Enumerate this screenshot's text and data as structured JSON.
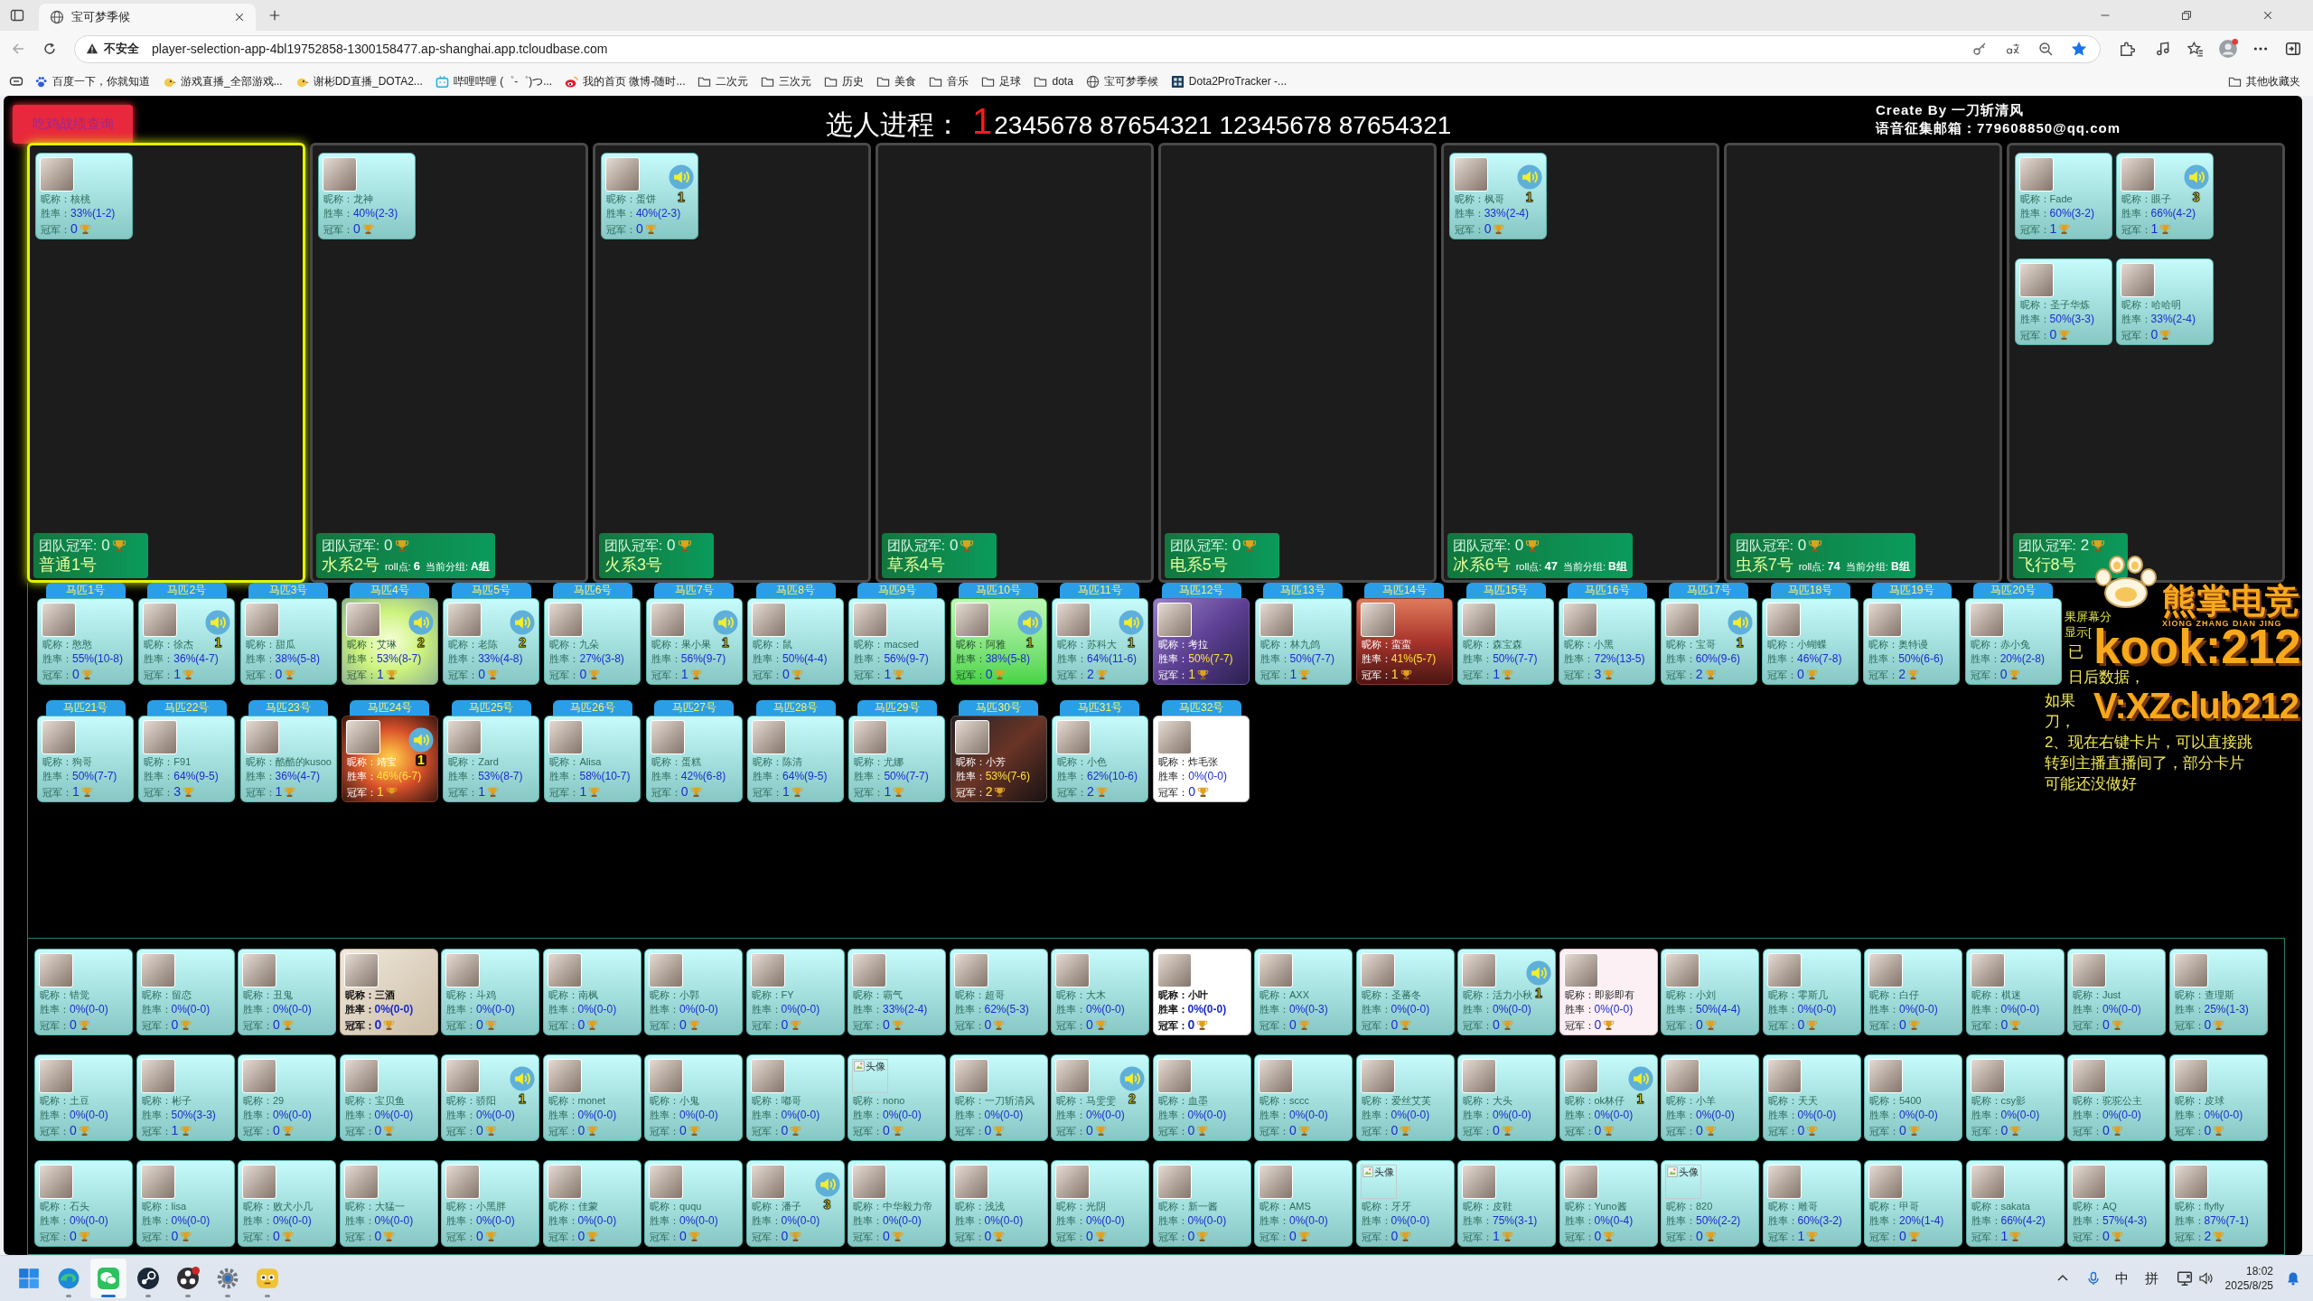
{
  "browser": {
    "tab_title": "宝可梦季候",
    "security_label": "不安全",
    "url": "player-selection-app-4bl19752858-1300158477.ap-shanghai.app.tcloudbase.com",
    "bookmarks": [
      {
        "kind": "paw",
        "label": "百度一下，你就知道"
      },
      {
        "kind": "bird",
        "label": "游戏直播_全部游戏..."
      },
      {
        "kind": "bird",
        "label": "谢彬DD直播_DOTA2..."
      },
      {
        "kind": "tv",
        "label": "哔哩哔哩 (゜-゜)つ..."
      },
      {
        "kind": "eye",
        "label": "我的首页 微博-随时..."
      },
      {
        "kind": "folder",
        "label": "二次元"
      },
      {
        "kind": "folder",
        "label": "三次元"
      },
      {
        "kind": "folder",
        "label": "历史"
      },
      {
        "kind": "folder",
        "label": "美食"
      },
      {
        "kind": "folder",
        "label": "音乐"
      },
      {
        "kind": "folder",
        "label": "足球"
      },
      {
        "kind": "folder",
        "label": "dota"
      },
      {
        "kind": "globe",
        "label": "宝可梦季候"
      },
      {
        "kind": "tile",
        "label": "Dota2ProTracker -..."
      }
    ],
    "other_bookmarks": "其他收藏夹"
  },
  "page": {
    "query_button": "吃鸡战绩查询",
    "progress": {
      "label": "选人进程：",
      "current": "1",
      "rest": "2345678 87654321 12345678 87654321"
    },
    "credits": [
      "Create By 一刀斩清风",
      "语音征集邮箱：779608850@qq.com"
    ],
    "teams": [
      {
        "name": "普通1号",
        "selected": true,
        "champ_label": "团队冠军:",
        "champ": "0",
        "members": [
          {
            "nick_label": "昵称：",
            "nick": "核桃",
            "rate_label": "胜率：",
            "rate": "33%(1-2)",
            "champ_label": "冠军：",
            "champ": "0",
            "kind": "plain"
          }
        ]
      },
      {
        "name": "水系2号",
        "selected": false,
        "champ_label": "团队冠军:",
        "champ": "0",
        "roll_label": "roll点:",
        "roll": "6",
        "group_label": "当前分组:",
        "group": "A组",
        "members": [
          {
            "nick_label": "昵称：",
            "nick": "龙神",
            "rate_label": "胜率：",
            "rate": "40%(2-3)",
            "champ_label": "冠军：",
            "champ": "0",
            "kind": "plain"
          }
        ]
      },
      {
        "name": "火系3号",
        "selected": false,
        "champ_label": "团队冠军:",
        "champ": "0",
        "members": [
          {
            "nick_label": "昵称：",
            "nick": "蛋饼",
            "rate_label": "胜率：",
            "rate": "40%(2-3)",
            "champ_label": "冠军：",
            "champ": "0",
            "kind": "plain",
            "voice": "1"
          }
        ]
      },
      {
        "name": "草系4号",
        "selected": false,
        "champ_label": "团队冠军:",
        "champ": "0"
      },
      {
        "name": "电系5号",
        "selected": false,
        "champ_label": "团队冠军:",
        "champ": "0"
      },
      {
        "name": "冰系6号",
        "selected": false,
        "champ_label": "团队冠军:",
        "champ": "0",
        "roll_label": "roll点:",
        "roll": "47",
        "group_label": "当前分组:",
        "group": "B组",
        "members": [
          {
            "nick_label": "昵称：",
            "nick": "枫哥",
            "rate_label": "胜率：",
            "rate": "33%(2-4)",
            "champ_label": "冠军：",
            "champ": "0",
            "kind": "plain",
            "voice": "1"
          }
        ]
      },
      {
        "name": "虫系7号",
        "selected": false,
        "champ_label": "团队冠军:",
        "champ": "0",
        "roll_label": "roll点:",
        "roll": "74",
        "group_label": "当前分组:",
        "group": "B组"
      },
      {
        "name": "飞行8号",
        "selected": false,
        "champ_label": "团队冠军:",
        "champ": "2",
        "members": [
          {
            "nick_label": "昵称：",
            "nick": "Fade",
            "rate_label": "胜率：",
            "rate": "60%(3-2)",
            "champ_label": "冠军：",
            "champ": "1",
            "kind": "plain"
          },
          {
            "nick_label": "昵称：",
            "nick": "眼子",
            "rate_label": "胜率：",
            "rate": "66%(4-2)",
            "champ_label": "冠军：",
            "champ": "1",
            "kind": "plain",
            "voice": "3"
          },
          {
            "nick_label": "昵称：",
            "nick": "圣子华炼",
            "rate_label": "胜率：",
            "rate": "50%(3-3)",
            "champ_label": "冠军：",
            "champ": "0",
            "kind": "plain"
          },
          {
            "nick_label": "昵称：",
            "nick": "哈哈明",
            "rate_label": "胜率：",
            "rate": "33%(2-4)",
            "champ_label": "冠军：",
            "champ": "0",
            "kind": "plain"
          }
        ]
      }
    ],
    "horses": [
      {
        "label": "马匹1号",
        "player": {
          "nick_label": "昵称：",
          "nick": "憨憨",
          "rate_label": "胜率：",
          "rate": "55%(10-8)",
          "champ_label": "冠军：",
          "champ": "0",
          "kind": "plain"
        }
      },
      {
        "label": "马匹2号",
        "player": {
          "nick_label": "昵称：",
          "nick": "徐杰",
          "rate_label": "胜率：",
          "rate": "36%(4-7)",
          "champ_label": "冠军：",
          "champ": "1",
          "kind": "plain",
          "voice": "1"
        }
      },
      {
        "label": "马匹3号",
        "player": {
          "nick_label": "昵称：",
          "nick": "甜瓜",
          "rate_label": "胜率：",
          "rate": "38%(5-8)",
          "champ_label": "冠军：",
          "champ": "0",
          "kind": "plain"
        }
      },
      {
        "label": "马匹4号",
        "player": {
          "nick_label": "昵称：",
          "nick": "艾琳",
          "rate_label": "胜率：",
          "rate": "53%(8-7)",
          "champ_label": "冠军：",
          "champ": "1",
          "kind": "glow",
          "voice": "2"
        }
      },
      {
        "label": "马匹5号",
        "player": {
          "nick_label": "昵称：",
          "nick": "老陈",
          "rate_label": "胜率：",
          "rate": "33%(4-8)",
          "champ_label": "冠军：",
          "champ": "0",
          "kind": "plain",
          "voice": "2"
        }
      },
      {
        "label": "马匹6号",
        "player": {
          "nick_label": "昵称：",
          "nick": "九朵",
          "rate_label": "胜率：",
          "rate": "27%(3-8)",
          "champ_label": "冠军：",
          "champ": "0",
          "kind": "plain"
        }
      },
      {
        "label": "马匹7号",
        "player": {
          "nick_label": "昵称：",
          "nick": "果小果",
          "rate_label": "胜率：",
          "rate": "56%(9-7)",
          "champ_label": "冠军：",
          "champ": "1",
          "kind": "plain",
          "voice": "1"
        }
      },
      {
        "label": "马匹8号",
        "player": {
          "nick_label": "昵称：",
          "nick": "鼠",
          "rate_label": "胜率：",
          "rate": "50%(4-4)",
          "champ_label": "冠军：",
          "champ": "0",
          "kind": "plain"
        }
      },
      {
        "label": "马匹9号",
        "player": {
          "nick_label": "昵称：",
          "nick": "macsed",
          "rate_label": "胜率：",
          "rate": "56%(9-7)",
          "champ_label": "冠军：",
          "champ": "1",
          "kind": "plain"
        }
      },
      {
        "label": "马匹10号",
        "player": {
          "nick_label": "昵称：",
          "nick": "阿雅",
          "rate_label": "胜率：",
          "rate": "38%(5-8)",
          "champ_label": "冠军：",
          "champ": "0",
          "kind": "green",
          "voice": "1"
        }
      },
      {
        "label": "马匹11号",
        "player": {
          "nick_label": "昵称：",
          "nick": "苏科大",
          "rate_label": "胜率：",
          "rate": "64%(11-6)",
          "champ_label": "冠军：",
          "champ": "2",
          "kind": "plain",
          "voice": "1"
        }
      },
      {
        "label": "马匹12号",
        "player": {
          "nick_label": "昵称：",
          "nick": "考拉",
          "rate_label": "胜率：",
          "rate": "50%(7-7)",
          "champ_label": "冠军：",
          "champ": "1",
          "kind": "violet"
        }
      },
      {
        "label": "马匹13号",
        "player": {
          "nick_label": "昵称：",
          "nick": "林九鸽",
          "rate_label": "胜率：",
          "rate": "50%(7-7)",
          "champ_label": "冠军：",
          "champ": "1",
          "kind": "plain"
        }
      },
      {
        "label": "马匹14号",
        "player": {
          "nick_label": "昵称：",
          "nick": "蛮蛮",
          "rate_label": "胜率：",
          "rate": "41%(5-7)",
          "champ_label": "冠军：",
          "champ": "1",
          "kind": "crimson"
        }
      },
      {
        "label": "马匹15号",
        "player": {
          "nick_label": "昵称：",
          "nick": "森宝森",
          "rate_label": "胜率：",
          "rate": "50%(7-7)",
          "champ_label": "冠军：",
          "champ": "1",
          "kind": "plain"
        }
      },
      {
        "label": "马匹16号",
        "player": {
          "nick_label": "昵称：",
          "nick": "小黑",
          "rate_label": "胜率：",
          "rate": "72%(13-5)",
          "champ_label": "冠军：",
          "champ": "3",
          "kind": "plain"
        }
      },
      {
        "label": "马匹17号",
        "player": {
          "nick_label": "昵称：",
          "nick": "宝哥",
          "rate_label": "胜率：",
          "rate": "60%(9-6)",
          "champ_label": "冠军：",
          "champ": "2",
          "kind": "plain",
          "voice": "1"
        }
      },
      {
        "label": "马匹18号",
        "player": {
          "nick_label": "昵称：",
          "nick": "小蝴蝶",
          "rate_label": "胜率：",
          "rate": "46%(7-8)",
          "champ_label": "冠军：",
          "champ": "0",
          "kind": "plain"
        }
      },
      {
        "label": "马匹19号",
        "player": {
          "nick_label": "昵称：",
          "nick": "奥特谩",
          "rate_label": "胜率：",
          "rate": "50%(6-6)",
          "champ_label": "冠军：",
          "champ": "2",
          "kind": "plain"
        }
      },
      {
        "label": "马匹20号",
        "player": {
          "nick_label": "昵称：",
          "nick": "赤小兔",
          "rate_label": "胜率：",
          "rate": "20%(2-8)",
          "champ_label": "冠军：",
          "champ": "0",
          "kind": "plain"
        }
      },
      {
        "label": "马匹21号",
        "player": {
          "nick_label": "昵称：",
          "nick": "狗哥",
          "rate_label": "胜率：",
          "rate": "50%(7-7)",
          "champ_label": "冠军：",
          "champ": "1",
          "kind": "plain"
        }
      },
      {
        "label": "马匹22号",
        "player": {
          "nick_label": "昵称：",
          "nick": "F91",
          "rate_label": "胜率：",
          "rate": "64%(9-5)",
          "champ_label": "冠军：",
          "champ": "3",
          "kind": "plain"
        }
      },
      {
        "label": "马匹23号",
        "player": {
          "nick_label": "昵称：",
          "nick": "酷酷的kusoo",
          "rate_label": "胜率：",
          "rate": "36%(4-7)",
          "champ_label": "冠军：",
          "champ": "1",
          "kind": "plain"
        }
      },
      {
        "label": "马匹24号",
        "player": {
          "nick_label": "昵称：",
          "nick": "靖宝",
          "rate_label": "胜率：",
          "rate": "46%(6-7)",
          "champ_label": "冠军：",
          "champ": "1",
          "kind": "fire",
          "voice": "1"
        }
      },
      {
        "label": "马匹25号",
        "player": {
          "nick_label": "昵称：",
          "nick": "Zard",
          "rate_label": "胜率：",
          "rate": "53%(8-7)",
          "champ_label": "冠军：",
          "champ": "1",
          "kind": "plain"
        }
      },
      {
        "label": "马匹26号",
        "player": {
          "nick_label": "昵称：",
          "nick": "Alisa",
          "rate_label": "胜率：",
          "rate": "58%(10-7)",
          "champ_label": "冠军：",
          "champ": "1",
          "kind": "plain"
        }
      },
      {
        "label": "马匹27号",
        "player": {
          "nick_label": "昵称：",
          "nick": "蛋糕",
          "rate_label": "胜率：",
          "rate": "42%(6-8)",
          "champ_label": "冠军：",
          "champ": "0",
          "kind": "plain"
        }
      },
      {
        "label": "马匹28号",
        "player": {
          "nick_label": "昵称：",
          "nick": "陈清",
          "rate_label": "胜率：",
          "rate": "64%(9-5)",
          "champ_label": "冠军：",
          "champ": "1",
          "kind": "plain"
        }
      },
      {
        "label": "马匹29号",
        "player": {
          "nick_label": "昵称：",
          "nick": "尤娜",
          "rate_label": "胜率：",
          "rate": "50%(7-7)",
          "champ_label": "冠军：",
          "champ": "1",
          "kind": "plain"
        }
      },
      {
        "label": "马匹30号",
        "player": {
          "nick_label": "昵称：",
          "nick": "小芳",
          "rate_label": "胜率：",
          "rate": "53%(7-6)",
          "champ_label": "冠军：",
          "champ": "2",
          "kind": "dark"
        }
      },
      {
        "label": "马匹31号",
        "player": {
          "nick_label": "昵称：",
          "nick": "小色",
          "rate_label": "胜率：",
          "rate": "62%(10-6)",
          "champ_label": "冠军：",
          "champ": "2",
          "kind": "plain"
        }
      },
      {
        "label": "马匹32号",
        "player": {
          "nick_label": "昵称：",
          "nick": "炸毛张",
          "rate_label": "胜率：",
          "rate": "0%(0-0)",
          "champ_label": "冠军：",
          "champ": "0",
          "kind": "white"
        }
      }
    ],
    "pool": [
      {
        "nick_label": "昵称：",
        "nick": "错觉",
        "rate_label": "胜率：",
        "rate": "0%(0-0)",
        "champ_label": "冠军：",
        "champ": "0",
        "kind": "plain"
      },
      {
        "nick_label": "昵称：",
        "nick": "留恋",
        "rate_label": "胜率：",
        "rate": "0%(0-0)",
        "champ_label": "冠军：",
        "champ": "0",
        "kind": "plain"
      },
      {
        "nick_label": "昵称：",
        "nick": "丑鬼",
        "rate_label": "胜率：",
        "rate": "0%(0-0)",
        "champ_label": "冠军：",
        "champ": "0",
        "kind": "plain"
      },
      {
        "nick_label": "昵称：",
        "nick": "三酒",
        "rate_label": "胜率：",
        "rate": "0%(0-0)",
        "champ_label": "冠军：",
        "champ": "0",
        "kind": "sketch"
      },
      {
        "nick_label": "昵称：",
        "nick": "斗鸡",
        "rate_label": "胜率：",
        "rate": "0%(0-0)",
        "champ_label": "冠军：",
        "champ": "0",
        "kind": "plain"
      },
      {
        "nick_label": "昵称：",
        "nick": "南枫",
        "rate_label": "胜率：",
        "rate": "0%(0-0)",
        "champ_label": "冠军：",
        "champ": "0",
        "kind": "plain"
      },
      {
        "nick_label": "昵称：",
        "nick": "小郭",
        "rate_label": "胜率：",
        "rate": "0%(0-0)",
        "champ_label": "冠军：",
        "champ": "0",
        "kind": "plain"
      },
      {
        "nick_label": "昵称：",
        "nick": "FY",
        "rate_label": "胜率：",
        "rate": "0%(0-0)",
        "champ_label": "冠军：",
        "champ": "0",
        "kind": "plain"
      },
      {
        "nick_label": "昵称：",
        "nick": "霸气",
        "rate_label": "胜率：",
        "rate": "33%(2-4)",
        "champ_label": "冠军：",
        "champ": "0",
        "kind": "plain"
      },
      {
        "nick_label": "昵称：",
        "nick": "超哥",
        "rate_label": "胜率：",
        "rate": "62%(5-3)",
        "champ_label": "冠军：",
        "champ": "0",
        "kind": "plain"
      },
      {
        "nick_label": "昵称：",
        "nick": "大木",
        "rate_label": "胜率：",
        "rate": "0%(0-0)",
        "champ_label": "冠军：",
        "champ": "0",
        "kind": "plain"
      },
      {
        "nick_label": "昵称：",
        "nick": "小叶",
        "rate_label": "胜率：",
        "rate": "0%(0-0)",
        "champ_label": "冠军：",
        "champ": "0",
        "kind": "bold"
      },
      {
        "nick_label": "昵称：",
        "nick": "AXX",
        "rate_label": "胜率：",
        "rate": "0%(0-3)",
        "champ_label": "冠军：",
        "champ": "0",
        "kind": "plain"
      },
      {
        "nick_label": "昵称：",
        "nick": "圣蕃冬",
        "rate_label": "胜率：",
        "rate": "0%(0-0)",
        "champ_label": "冠军：",
        "champ": "0",
        "kind": "plain"
      },
      {
        "nick_label": "昵称：",
        "nick": "活力小秋",
        "rate_label": "胜率：",
        "rate": "0%(0-0)",
        "champ_label": "冠军：",
        "champ": "0",
        "kind": "plain",
        "voice": "1"
      },
      {
        "nick_label": "昵称：",
        "nick": "即影即有",
        "rate_label": "胜率：",
        "rate": "0%(0-0)",
        "champ_label": "冠军：",
        "champ": "0",
        "kind": "pink"
      },
      {
        "nick_label": "昵称：",
        "nick": "小刘",
        "rate_label": "胜率：",
        "rate": "50%(4-4)",
        "champ_label": "冠军：",
        "champ": "0",
        "kind": "plain"
      },
      {
        "nick_label": "昵称：",
        "nick": "零斯几",
        "rate_label": "胜率：",
        "rate": "0%(0-0)",
        "champ_label": "冠军：",
        "champ": "0",
        "kind": "plain"
      },
      {
        "nick_label": "昵称：",
        "nick": "白仔",
        "rate_label": "胜率：",
        "rate": "0%(0-0)",
        "champ_label": "冠军：",
        "champ": "0",
        "kind": "plain"
      },
      {
        "nick_label": "昵称：",
        "nick": "棋迷",
        "rate_label": "胜率：",
        "rate": "0%(0-0)",
        "champ_label": "冠军：",
        "champ": "0",
        "kind": "plain"
      },
      {
        "nick_label": "昵称：",
        "nick": "Just",
        "rate_label": "胜率：",
        "rate": "0%(0-0)",
        "champ_label": "冠军：",
        "champ": "0",
        "kind": "plain"
      },
      {
        "nick_label": "昵称：",
        "nick": "查理斯",
        "rate_label": "胜率：",
        "rate": "25%(1-3)",
        "champ_label": "冠军：",
        "champ": "0",
        "kind": "plain"
      },
      {
        "nick_label": "昵称：",
        "nick": "土豆",
        "rate_label": "胜率：",
        "rate": "0%(0-0)",
        "champ_label": "冠军：",
        "champ": "0",
        "kind": "plain"
      },
      {
        "nick_label": "昵称：",
        "nick": "彬子",
        "rate_label": "胜率：",
        "rate": "50%(3-3)",
        "champ_label": "冠军：",
        "champ": "1",
        "kind": "plain"
      },
      {
        "nick_label": "昵称：",
        "nick": "29",
        "rate_label": "胜率：",
        "rate": "0%(0-0)",
        "champ_label": "冠军：",
        "champ": "0",
        "kind": "plain"
      },
      {
        "nick_label": "昵称：",
        "nick": "宝贝鱼",
        "rate_label": "胜率：",
        "rate": "0%(0-0)",
        "champ_label": "冠军：",
        "champ": "0",
        "kind": "plain"
      },
      {
        "nick_label": "昵称：",
        "nick": "骄阳",
        "rate_label": "胜率：",
        "rate": "0%(0-0)",
        "champ_label": "冠军：",
        "champ": "0",
        "kind": "plain",
        "voice": "1"
      },
      {
        "nick_label": "昵称：",
        "nick": "monet",
        "rate_label": "胜率：",
        "rate": "0%(0-0)",
        "champ_label": "冠军：",
        "champ": "0",
        "kind": "plain"
      },
      {
        "nick_label": "昵称：",
        "nick": "小鬼",
        "rate_label": "胜率：",
        "rate": "0%(0-0)",
        "champ_label": "冠军：",
        "champ": "0",
        "kind": "plain"
      },
      {
        "nick_label": "昵称：",
        "nick": "嘟哥",
        "rate_label": "胜率：",
        "rate": "0%(0-0)",
        "champ_label": "冠军：",
        "champ": "0",
        "kind": "plain"
      },
      {
        "nick_label": "昵称：",
        "nick": "nono",
        "rate_label": "胜率：",
        "rate": "0%(0-0)",
        "champ_label": "冠军：",
        "champ": "0",
        "kind": "plain",
        "avatar_alt": "头像"
      },
      {
        "nick_label": "昵称：",
        "nick": "一刀斩清风",
        "rate_label": "胜率：",
        "rate": "0%(0-0)",
        "champ_label": "冠军：",
        "champ": "0",
        "kind": "plain"
      },
      {
        "nick_label": "昵称：",
        "nick": "马雯雯",
        "rate_label": "胜率：",
        "rate": "0%(0-0)",
        "champ_label": "冠军：",
        "champ": "0",
        "kind": "plain",
        "voice": "2"
      },
      {
        "nick_label": "昵称：",
        "nick": "血墨",
        "rate_label": "胜率：",
        "rate": "0%(0-0)",
        "champ_label": "冠军：",
        "champ": "0",
        "kind": "plain"
      },
      {
        "nick_label": "昵称：",
        "nick": "sccc",
        "rate_label": "胜率：",
        "rate": "0%(0-0)",
        "champ_label": "冠军：",
        "champ": "0",
        "kind": "plain"
      },
      {
        "nick_label": "昵称：",
        "nick": "爱丝艾芙",
        "rate_label": "胜率：",
        "rate": "0%(0-0)",
        "champ_label": "冠军：",
        "champ": "0",
        "kind": "plain"
      },
      {
        "nick_label": "昵称：",
        "nick": "大头",
        "rate_label": "胜率：",
        "rate": "0%(0-0)",
        "champ_label": "冠军：",
        "champ": "0",
        "kind": "plain"
      },
      {
        "nick_label": "昵称：",
        "nick": "ok林仔",
        "rate_label": "胜率：",
        "rate": "0%(0-0)",
        "champ_label": "冠军：",
        "champ": "0",
        "kind": "plain",
        "voice": "1"
      },
      {
        "nick_label": "昵称：",
        "nick": "小羊",
        "rate_label": "胜率：",
        "rate": "0%(0-0)",
        "champ_label": "冠军：",
        "champ": "0",
        "kind": "plain"
      },
      {
        "nick_label": "昵称：",
        "nick": "天天",
        "rate_label": "胜率：",
        "rate": "0%(0-0)",
        "champ_label": "冠军：",
        "champ": "0",
        "kind": "plain"
      },
      {
        "nick_label": "昵称：",
        "nick": "5400",
        "rate_label": "胜率：",
        "rate": "0%(0-0)",
        "champ_label": "冠军：",
        "champ": "0",
        "kind": "plain"
      },
      {
        "nick_label": "昵称：",
        "nick": "csy影",
        "rate_label": "胜率：",
        "rate": "0%(0-0)",
        "champ_label": "冠军：",
        "champ": "0",
        "kind": "plain"
      },
      {
        "nick_label": "昵称：",
        "nick": "驼驼公主",
        "rate_label": "胜率：",
        "rate": "0%(0-0)",
        "champ_label": "冠军：",
        "champ": "0",
        "kind": "plain"
      },
      {
        "nick_label": "昵称：",
        "nick": "皮球",
        "rate_label": "胜率：",
        "rate": "0%(0-0)",
        "champ_label": "冠军：",
        "champ": "0",
        "kind": "plain"
      },
      {
        "nick_label": "昵称：",
        "nick": "石头",
        "rate_label": "胜率：",
        "rate": "0%(0-0)",
        "champ_label": "冠军：",
        "champ": "0",
        "kind": "plain"
      },
      {
        "nick_label": "昵称：",
        "nick": "lisa",
        "rate_label": "胜率：",
        "rate": "0%(0-0)",
        "champ_label": "冠军：",
        "champ": "0",
        "kind": "plain"
      },
      {
        "nick_label": "昵称：",
        "nick": "败犬小几",
        "rate_label": "胜率：",
        "rate": "0%(0-0)",
        "champ_label": "冠军：",
        "champ": "0",
        "kind": "plain"
      },
      {
        "nick_label": "昵称：",
        "nick": "大猛一",
        "rate_label": "胜率：",
        "rate": "0%(0-0)",
        "champ_label": "冠军：",
        "champ": "0",
        "kind": "plain"
      },
      {
        "nick_label": "昵称：",
        "nick": "小黑胖",
        "rate_label": "胜率：",
        "rate": "0%(0-0)",
        "champ_label": "冠军：",
        "champ": "0",
        "kind": "plain"
      },
      {
        "nick_label": "昵称：",
        "nick": "佳蒙",
        "rate_label": "胜率：",
        "rate": "0%(0-0)",
        "champ_label": "冠军：",
        "champ": "0",
        "kind": "plain"
      },
      {
        "nick_label": "昵称：",
        "nick": "ququ",
        "rate_label": "胜率：",
        "rate": "0%(0-0)",
        "champ_label": "冠军：",
        "champ": "0",
        "kind": "plain"
      },
      {
        "nick_label": "昵称：",
        "nick": "潘子",
        "rate_label": "胜率：",
        "rate": "0%(0-0)",
        "champ_label": "冠军：",
        "champ": "0",
        "kind": "plain",
        "voice": "3"
      },
      {
        "nick_label": "昵称：",
        "nick": "中华毅力帝",
        "rate_label": "胜率：",
        "rate": "0%(0-0)",
        "champ_label": "冠军：",
        "champ": "0",
        "kind": "plain"
      },
      {
        "nick_label": "昵称：",
        "nick": "浅浅",
        "rate_label": "胜率：",
        "rate": "0%(0-0)",
        "champ_label": "冠军：",
        "champ": "0",
        "kind": "plain"
      },
      {
        "nick_label": "昵称：",
        "nick": "光阴",
        "rate_label": "胜率：",
        "rate": "0%(0-0)",
        "champ_label": "冠军：",
        "champ": "0",
        "kind": "plain"
      },
      {
        "nick_label": "昵称：",
        "nick": "新一酱",
        "rate_label": "胜率：",
        "rate": "0%(0-0)",
        "champ_label": "冠军：",
        "champ": "0",
        "kind": "plain"
      },
      {
        "nick_label": "昵称：",
        "nick": "AMS",
        "rate_label": "胜率：",
        "rate": "0%(0-0)",
        "champ_label": "冠军：",
        "champ": "0",
        "kind": "plain"
      },
      {
        "nick_label": "昵称：",
        "nick": "牙牙",
        "rate_label": "胜率：",
        "rate": "0%(0-0)",
        "champ_label": "冠军：",
        "champ": "0",
        "kind": "plain",
        "avatar_alt": "头像"
      },
      {
        "nick_label": "昵称：",
        "nick": "皮鞋",
        "rate_label": "胜率：",
        "rate": "75%(3-1)",
        "champ_label": "冠军：",
        "champ": "1",
        "kind": "plain"
      },
      {
        "nick_label": "昵称：",
        "nick": "Yuno酱",
        "rate_label": "胜率：",
        "rate": "0%(0-4)",
        "champ_label": "冠军：",
        "champ": "0",
        "kind": "plain"
      },
      {
        "nick_label": "昵称：",
        "nick": "820",
        "rate_label": "胜率：",
        "rate": "50%(2-2)",
        "champ_label": "冠军：",
        "champ": "0",
        "kind": "plain",
        "avatar_alt": "头像"
      },
      {
        "nick_label": "昵称：",
        "nick": "雕哥",
        "rate_label": "胜率：",
        "rate": "60%(3-2)",
        "champ_label": "冠军：",
        "champ": "1",
        "kind": "plain"
      },
      {
        "nick_label": "昵称：",
        "nick": "甲哥",
        "rate_label": "胜率：",
        "rate": "20%(1-4)",
        "champ_label": "冠军：",
        "champ": "0",
        "kind": "plain"
      },
      {
        "nick_label": "昵称：",
        "nick": "sakata",
        "rate_label": "胜率：",
        "rate": "66%(4-2)",
        "champ_label": "冠军：",
        "champ": "1",
        "kind": "plain"
      },
      {
        "nick_label": "昵称：",
        "nick": "AQ",
        "rate_label": "胜率：",
        "rate": "57%(4-3)",
        "champ_label": "冠军：",
        "champ": "0",
        "kind": "plain"
      },
      {
        "nick_label": "昵称：",
        "nick": "flyfly",
        "rate_label": "胜率：",
        "rate": "87%(7-1)",
        "champ_label": "冠军：",
        "champ": "2",
        "kind": "plain"
      }
    ],
    "notice": [
      {
        "kind": "small",
        "text": "果屏幕分"
      },
      {
        "kind": "small",
        "text": "显示["
      },
      {
        "kind": "indented",
        "text": "已"
      },
      {
        "kind": "indented",
        "text": "日后数据，"
      },
      {
        "kind": "plain",
        "text": "如果"
      },
      {
        "kind": "plain",
        "text": "刀，"
      },
      {
        "kind": "plain",
        "text": "2、现在右键卡片，可以直接跳"
      },
      {
        "kind": "plain",
        "text": "转到主播直播间了，部分卡片"
      },
      {
        "kind": "plain",
        "text": "可能还没做好"
      }
    ],
    "overlay": {
      "title": "熊掌电竞",
      "subtitle": "XIONG ZHANG DIAN JING",
      "lines": [
        "kook:212",
        "V:XZclub212"
      ]
    }
  },
  "taskbar": {
    "apps": [
      {
        "kind": "start",
        "running": false,
        "selected": false,
        "badge": false
      },
      {
        "kind": "browser",
        "running": true,
        "selected": false,
        "badge": false
      },
      {
        "kind": "chat",
        "running": true,
        "selected": true,
        "badge": false
      },
      {
        "kind": "launcher",
        "running": true,
        "selected": false,
        "badge": false
      },
      {
        "kind": "recorder",
        "running": true,
        "selected": false,
        "badge": true
      },
      {
        "kind": "settings",
        "running": true,
        "selected": false,
        "badge": false
      },
      {
        "kind": "mascot",
        "running": true,
        "selected": false,
        "badge": false
      }
    ],
    "ime_mode": "中",
    "ime_name": "拼",
    "time": "18:02",
    "date": "2025/8/25"
  }
}
